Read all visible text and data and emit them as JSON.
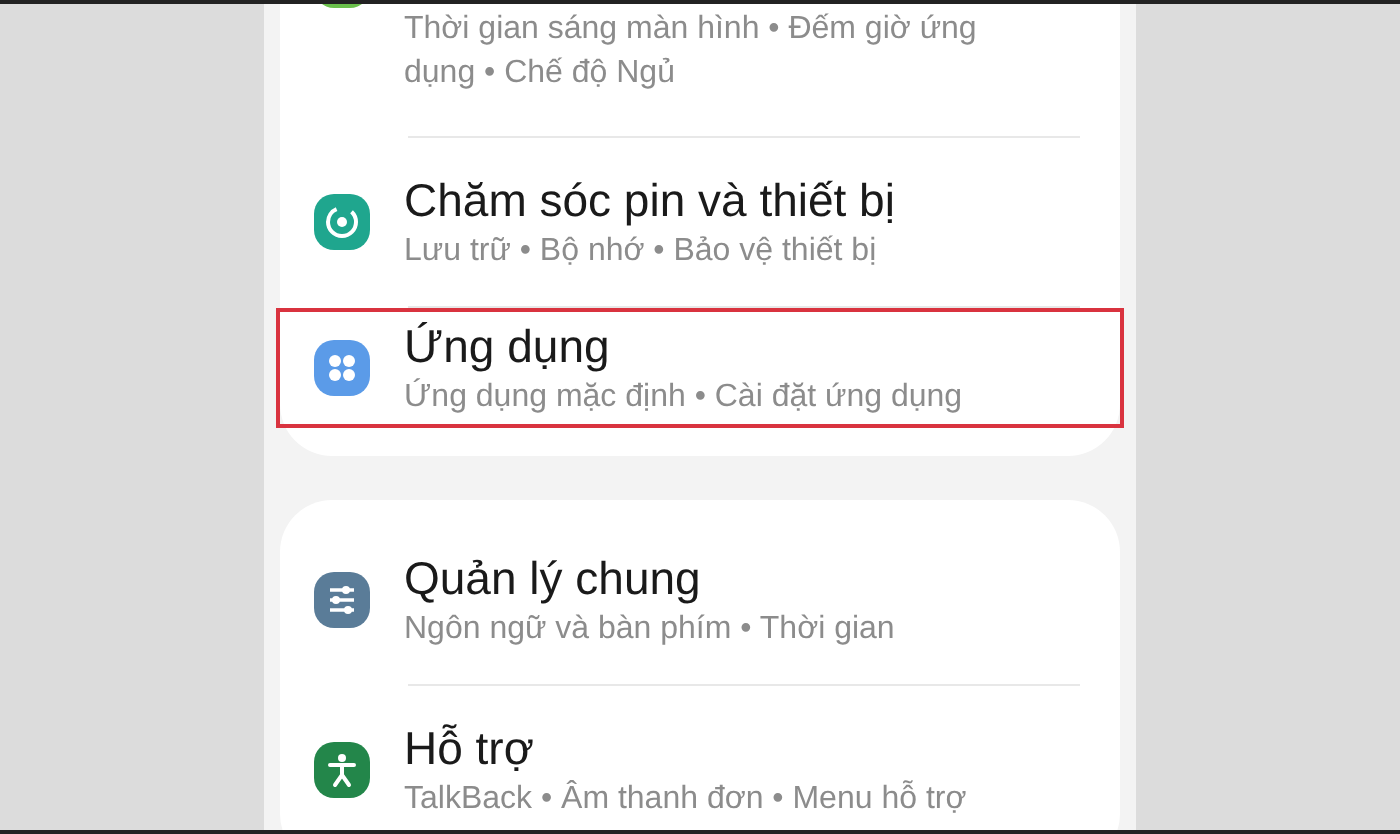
{
  "cards": [
    {
      "items": [
        {
          "kind": "wellbeing",
          "subtitle": "Thời gian sáng màn hình • Đếm giờ ứng dụng • Chế độ Ngủ",
          "selected": false
        },
        {
          "kind": "device-care",
          "title": "Chăm sóc pin và thiết bị",
          "subtitle": "Lưu trữ • Bộ nhớ • Bảo vệ thiết bị",
          "selected": false
        },
        {
          "kind": "apps",
          "title": "Ứng dụng",
          "subtitle": "Ứng dụng mặc định • Cài đặt ứng dụng",
          "selected": true
        }
      ]
    },
    {
      "items": [
        {
          "kind": "general",
          "title": "Quản lý chung",
          "subtitle": "Ngôn ngữ và bàn phím • Thời gian",
          "selected": false
        },
        {
          "kind": "accessibility",
          "title": "Hỗ trợ",
          "subtitle": "TalkBack • Âm thanh đơn • Menu hỗ trợ",
          "selected": false
        }
      ]
    }
  ]
}
